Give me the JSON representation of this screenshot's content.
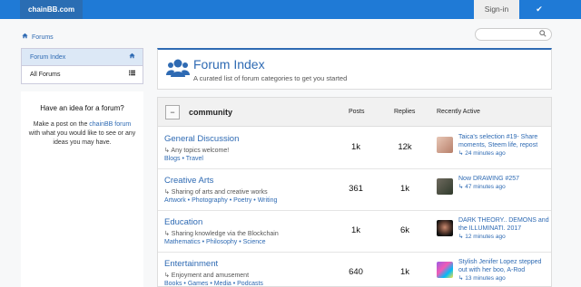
{
  "topbar": {
    "brand": "chainBB.com",
    "signin_label": "Sign-in",
    "check_icon": "✔"
  },
  "breadcrumb": {
    "icon": "home-icon",
    "label": "Forums"
  },
  "search": {
    "placeholder": "",
    "icon": "search-icon"
  },
  "sidenav": {
    "items": [
      {
        "label": "Forum Index",
        "icon": "home-icon",
        "active": true
      },
      {
        "label": "All Forums",
        "icon": "list-icon",
        "active": false
      }
    ]
  },
  "idea": {
    "heading": "Have an idea for a forum?",
    "text_before": "Make a post on the ",
    "link": "chainBB forum",
    "text_after": " with what you would like to see or any ideas you may have."
  },
  "header": {
    "title": "Forum Index",
    "subtitle": "A curated list of forum categories to get you started",
    "icon": "users-icon"
  },
  "category": {
    "collapse_label": "−",
    "name": "community",
    "col_posts": "Posts",
    "col_replies": "Replies",
    "col_active": "Recently Active",
    "rows": [
      {
        "name": "General Discussion",
        "desc": "↳ Any topics welcome!",
        "tags": [
          "Blogs",
          "Travel"
        ],
        "posts": "1k",
        "replies": "12k",
        "active_title": "Taica's selection #19- Share moments, Steem life, repost",
        "active_when": "↳ 24 minutes ago"
      },
      {
        "name": "Creative Arts",
        "desc": "↳ Sharing of arts and creative works",
        "tags": [
          "Artwork",
          "Photography",
          "Poetry",
          "Writing"
        ],
        "posts": "361",
        "replies": "1k",
        "active_title": "Now DRAWING #257",
        "active_when": "↳ 47 minutes ago"
      },
      {
        "name": "Education",
        "desc": "↳ Sharing knowledge via the Blockchain",
        "tags": [
          "Mathematics",
          "Philosophy",
          "Science"
        ],
        "posts": "1k",
        "replies": "6k",
        "active_title": "DARK THEORY.. DEMONS and the ILLUMINATI. 2017",
        "active_when": "↳ 12 minutes ago"
      },
      {
        "name": "Entertainment",
        "desc": "↳ Enjoyment and amusement",
        "tags": [
          "Books",
          "Games",
          "Media",
          "Podcasts"
        ],
        "posts": "640",
        "replies": "1k",
        "active_title": "Stylish Jenifer Lopez stepped out with her boo, A-Rod",
        "active_when": "↳ 13 minutes ago"
      }
    ]
  },
  "colors": {
    "brand": "#1f7ad6",
    "link": "#2e6ab3",
    "active_bg": "#dce8f6"
  }
}
